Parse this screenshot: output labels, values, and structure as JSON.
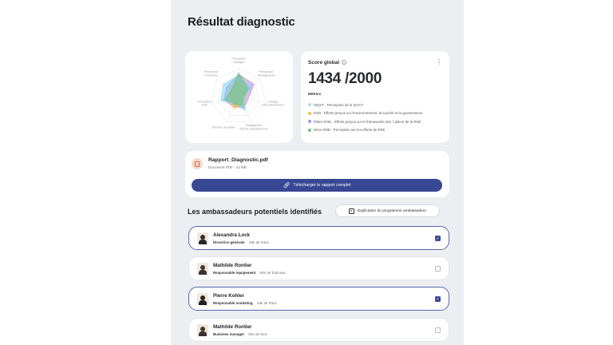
{
  "page": {
    "title": "Résultat diagnostic"
  },
  "radar": {
    "axes": [
      "Perception\nCollègue",
      "Perception\nManagement",
      "Prestige\nentreprise/secteur",
      "Engagement\neffectif organisationnel",
      "Intention de quitter",
      "Perception\nRSE",
      "Perception\nEntreprise"
    ],
    "series": [
      {
        "color": "#b58be0",
        "values": [
          0.8,
          0.7,
          0.35,
          0.45,
          0.4,
          0.55,
          0.55
        ]
      },
      {
        "color": "#f2c04d",
        "values": [
          0.55,
          0.4,
          0.25,
          0.4,
          0.45,
          0.3,
          0.4
        ]
      },
      {
        "color": "#7fd3ef",
        "values": [
          0.75,
          0.55,
          0.2,
          0.55,
          0.25,
          0.65,
          0.7
        ]
      },
      {
        "color": "#6cc07a",
        "values": [
          0.85,
          0.45,
          0.15,
          0.35,
          0.3,
          0.5,
          0.35
        ]
      }
    ]
  },
  "score": {
    "title": "Score global",
    "value": "1434 /2000",
    "metrics_label": "Metrics",
    "legend": [
      {
        "label": "ISQVT : Perception de la QVCT",
        "color": "#a8def2"
      },
      {
        "label": "ESG : Efforts perçus sur l'environnement, la société et la gouvernance",
        "color": "#f2c04d"
      },
      {
        "label": "Piliers RSE : Efforts perçus sur le frameworks des 7 piliers de la RSE",
        "color": "#b58be0"
      },
      {
        "label": "Micro RSE : Perception sur les efforts de RSE",
        "color": "#6cc07a"
      }
    ]
  },
  "file": {
    "name": "Rapport_Diagnostic.pdf",
    "meta": "Document PDF - 23 MB",
    "download_label": "Télécharger le rapport complet"
  },
  "ambassadors": {
    "title": "Les ambassadeurs potentiels identifiés",
    "explain_label": "Explication du programme ambassadeur",
    "items": [
      {
        "name": "Alexandra Lock",
        "role": "Directrice générale",
        "site": "Site de Paris",
        "checked": true
      },
      {
        "name": "Mathilde Rontier",
        "role": "Responsable équipement",
        "site": "Site de Toulouse",
        "checked": false
      },
      {
        "name": "Pierre Kohler",
        "role": "Responsable marketing",
        "site": "Site de Paris",
        "checked": true
      },
      {
        "name": "Mathilde Rontier",
        "role": "Business manager",
        "site": "Site de Nice",
        "checked": false
      }
    ]
  }
}
